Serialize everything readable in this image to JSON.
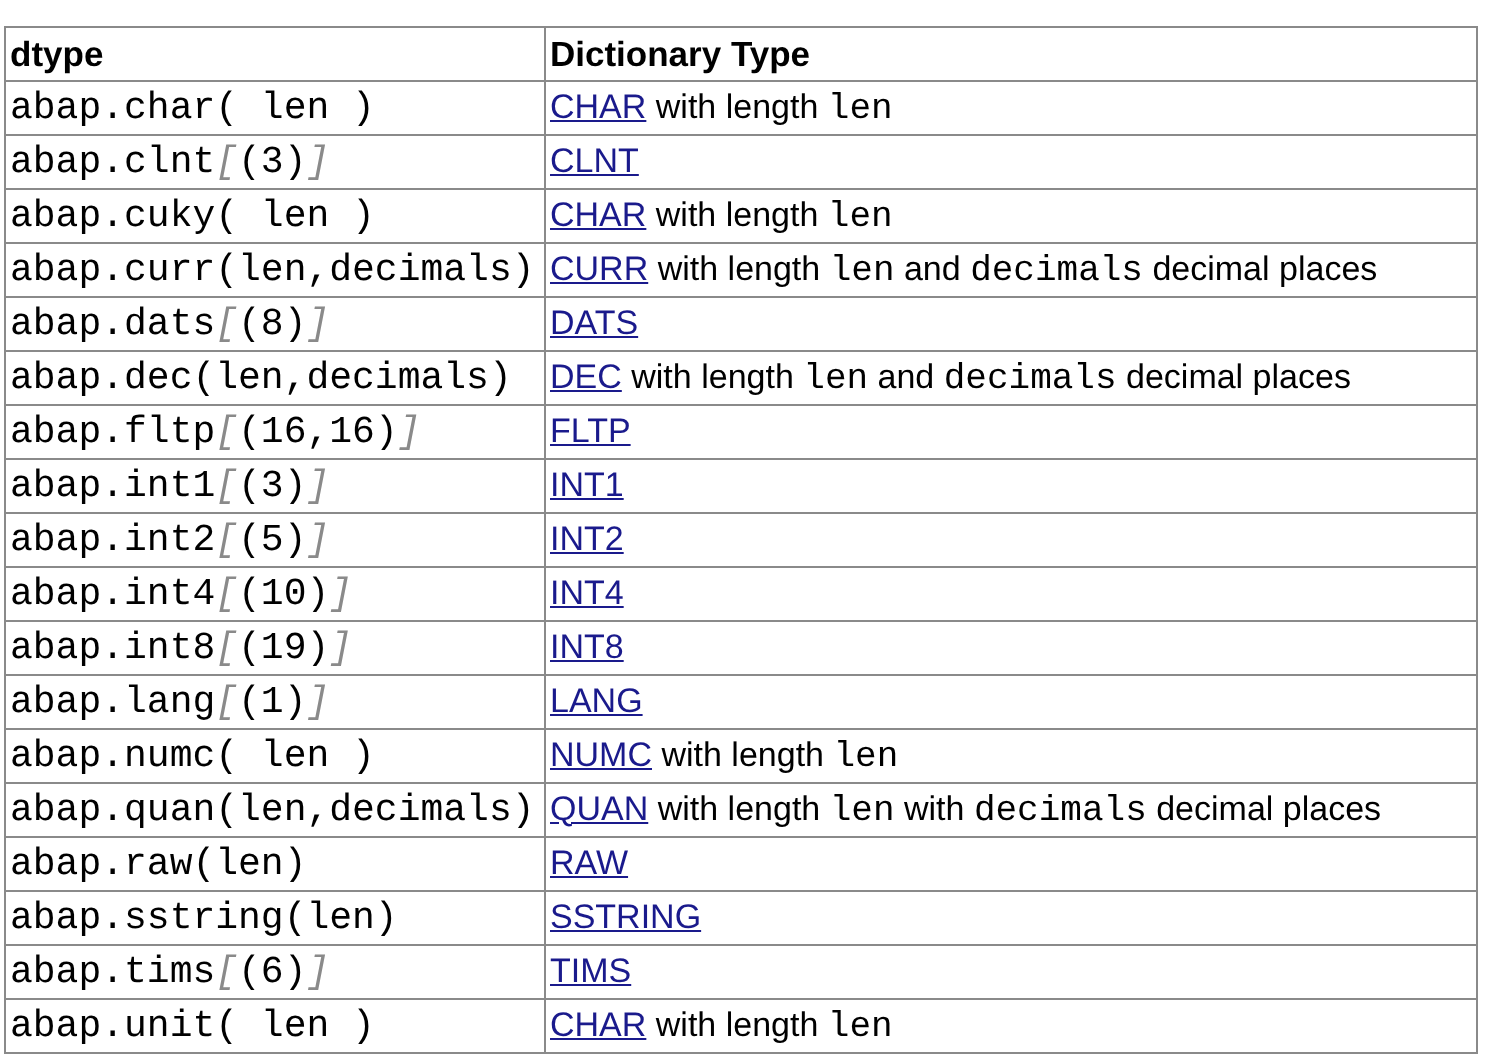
{
  "table": {
    "columns": [
      "dtype",
      "Dictionary Type"
    ],
    "rows": [
      {
        "dtype": "abap.char( len )",
        "type": [
          {
            "kind": "link",
            "text": "CHAR"
          },
          {
            "kind": "text",
            "text": " with length "
          },
          {
            "kind": "code",
            "text": "len"
          }
        ]
      },
      {
        "dtype": [
          {
            "kind": "code",
            "text": "abap.clnt"
          },
          {
            "kind": "bracket",
            "text": "["
          },
          {
            "kind": "code",
            "text": "(3)"
          },
          {
            "kind": "bracket",
            "text": "]"
          }
        ],
        "type": [
          {
            "kind": "link",
            "text": "CLNT"
          }
        ]
      },
      {
        "dtype": "abap.cuky( len )",
        "type": [
          {
            "kind": "link",
            "text": "CHAR"
          },
          {
            "kind": "text",
            "text": " with length "
          },
          {
            "kind": "code",
            "text": "len"
          }
        ]
      },
      {
        "dtype": "abap.curr(len,decimals)",
        "type": [
          {
            "kind": "link",
            "text": "CURR"
          },
          {
            "kind": "text",
            "text": " with length "
          },
          {
            "kind": "code",
            "text": "len"
          },
          {
            "kind": "text",
            "text": " and "
          },
          {
            "kind": "code",
            "text": "decimals"
          },
          {
            "kind": "text",
            "text": " decimal places"
          }
        ]
      },
      {
        "dtype": [
          {
            "kind": "code",
            "text": "abap.dats"
          },
          {
            "kind": "bracket",
            "text": "["
          },
          {
            "kind": "code",
            "text": "(8)"
          },
          {
            "kind": "bracket",
            "text": "]"
          }
        ],
        "type": [
          {
            "kind": "link",
            "text": "DATS"
          }
        ]
      },
      {
        "dtype": "abap.dec(len,decimals)",
        "type": [
          {
            "kind": "link",
            "text": "DEC"
          },
          {
            "kind": "text",
            "text": " with length "
          },
          {
            "kind": "code",
            "text": "len"
          },
          {
            "kind": "text",
            "text": " and "
          },
          {
            "kind": "code",
            "text": "decimals"
          },
          {
            "kind": "text",
            "text": " decimal places"
          }
        ]
      },
      {
        "dtype": [
          {
            "kind": "code",
            "text": "abap.fltp"
          },
          {
            "kind": "bracket",
            "text": "["
          },
          {
            "kind": "code",
            "text": "(16,16)"
          },
          {
            "kind": "bracket",
            "text": "]"
          }
        ],
        "type": [
          {
            "kind": "link",
            "text": "FLTP"
          }
        ]
      },
      {
        "dtype": [
          {
            "kind": "code",
            "text": "abap.int1"
          },
          {
            "kind": "bracket",
            "text": "["
          },
          {
            "kind": "code",
            "text": "(3)"
          },
          {
            "kind": "bracket",
            "text": "]"
          }
        ],
        "type": [
          {
            "kind": "link",
            "text": "INT1"
          }
        ]
      },
      {
        "dtype": [
          {
            "kind": "code",
            "text": "abap.int2"
          },
          {
            "kind": "bracket",
            "text": "["
          },
          {
            "kind": "code",
            "text": "(5)"
          },
          {
            "kind": "bracket",
            "text": "]"
          }
        ],
        "type": [
          {
            "kind": "link",
            "text": "INT2"
          }
        ]
      },
      {
        "dtype": [
          {
            "kind": "code",
            "text": "abap.int4"
          },
          {
            "kind": "bracket",
            "text": "["
          },
          {
            "kind": "code",
            "text": "(10)"
          },
          {
            "kind": "bracket",
            "text": "]"
          }
        ],
        "type": [
          {
            "kind": "link",
            "text": "INT4"
          }
        ]
      },
      {
        "dtype": [
          {
            "kind": "code",
            "text": "abap.int8"
          },
          {
            "kind": "bracket",
            "text": "["
          },
          {
            "kind": "code",
            "text": "(19)"
          },
          {
            "kind": "bracket",
            "text": "]"
          }
        ],
        "type": [
          {
            "kind": "link",
            "text": "INT8"
          }
        ]
      },
      {
        "dtype": [
          {
            "kind": "code",
            "text": "abap.lang"
          },
          {
            "kind": "bracket",
            "text": "["
          },
          {
            "kind": "code",
            "text": "(1)"
          },
          {
            "kind": "bracket",
            "text": "]"
          }
        ],
        "type": [
          {
            "kind": "link",
            "text": "LANG"
          }
        ]
      },
      {
        "dtype": "abap.numc( len )",
        "type": [
          {
            "kind": "link",
            "text": "NUMC"
          },
          {
            "kind": "text",
            "text": " with length "
          },
          {
            "kind": "code",
            "text": "len"
          }
        ]
      },
      {
        "dtype": "abap.quan(len,decimals)",
        "type": [
          {
            "kind": "link",
            "text": "QUAN"
          },
          {
            "kind": "text",
            "text": " with length "
          },
          {
            "kind": "code",
            "text": "len"
          },
          {
            "kind": "text",
            "text": " with "
          },
          {
            "kind": "code",
            "text": "decimals"
          },
          {
            "kind": "text",
            "text": " decimal places"
          }
        ]
      },
      {
        "dtype": "abap.raw(len)",
        "type": [
          {
            "kind": "link",
            "text": "RAW"
          }
        ]
      },
      {
        "dtype": "abap.sstring(len)",
        "type": [
          {
            "kind": "link",
            "text": "SSTRING"
          }
        ]
      },
      {
        "dtype": [
          {
            "kind": "code",
            "text": "abap.tims"
          },
          {
            "kind": "bracket",
            "text": "["
          },
          {
            "kind": "code",
            "text": "(6)"
          },
          {
            "kind": "bracket",
            "text": "]"
          }
        ],
        "type": [
          {
            "kind": "link",
            "text": "TIMS"
          }
        ]
      },
      {
        "dtype": "abap.unit( len )",
        "type": [
          {
            "kind": "link",
            "text": "CHAR"
          },
          {
            "kind": "text",
            "text": " with length "
          },
          {
            "kind": "code",
            "text": "len"
          }
        ]
      }
    ]
  }
}
